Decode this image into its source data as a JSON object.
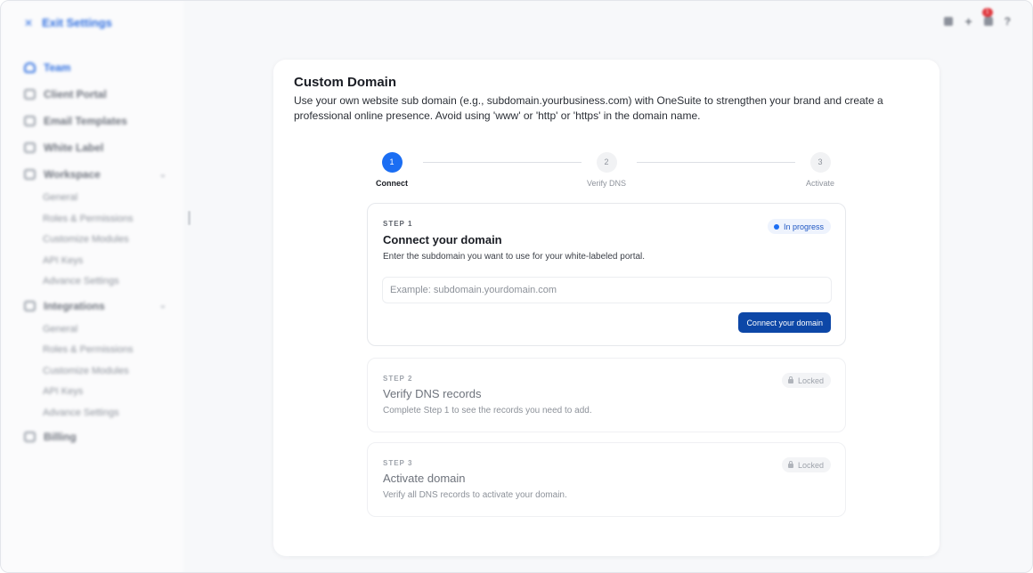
{
  "sidebar": {
    "exit_label": "Exit Settings",
    "items": [
      {
        "label": "Team",
        "icon": "user-icon",
        "active": true
      },
      {
        "label": "Client Portal",
        "icon": "portal-icon"
      },
      {
        "label": "Email Templates",
        "icon": "mail-icon"
      },
      {
        "label": "White Label",
        "icon": "tag-icon"
      },
      {
        "label": "Workspace",
        "icon": "workspace-icon",
        "expanded": true,
        "sub": [
          "General",
          "Roles & Permissions",
          "Customize Modules",
          "API Keys",
          "Advance Settings"
        ]
      },
      {
        "label": "Integrations",
        "icon": "integrations-icon",
        "expanded": true,
        "sub": [
          "General",
          "Roles & Permissions",
          "Customize Modules",
          "API Keys",
          "Advance Settings"
        ]
      },
      {
        "label": "Billing",
        "icon": "billing-icon"
      }
    ]
  },
  "topbar": {
    "notification_badge": "1"
  },
  "main": {
    "title": "Custom Domain",
    "description": "Use your own website sub domain (e.g., subdomain.yourbusiness.com) with OneSuite to strengthen your brand and create a professional online presence. Avoid using 'www' or 'http' or 'https' in the domain name.",
    "stepper": [
      {
        "number": "1",
        "label": "Connect",
        "active": true
      },
      {
        "number": "2",
        "label": "Verify DNS",
        "active": false
      },
      {
        "number": "3",
        "label": "Activate",
        "active": false
      }
    ],
    "steps": [
      {
        "step_label": "STEP 1",
        "title": "Connect your domain",
        "description": "Enter the subdomain you want to use for your white-labeled portal.",
        "status": "In progress",
        "input_placeholder": "Example: subdomain.yourdomain.com",
        "input_value": "",
        "button_label": "Connect your domain"
      },
      {
        "step_label": "STEP 2",
        "title": "Verify DNS records",
        "description": "Complete Step 1 to see the records you need to add.",
        "status": "Locked"
      },
      {
        "step_label": "STEP 3",
        "title": "Activate domain",
        "description": "Verify all DNS records to activate your domain.",
        "status": "Locked"
      }
    ]
  },
  "colors": {
    "accent": "#1b6ef3",
    "button": "#0d47a7",
    "sidebar_active": "#2f6fe0",
    "badge": "#e0383e"
  }
}
